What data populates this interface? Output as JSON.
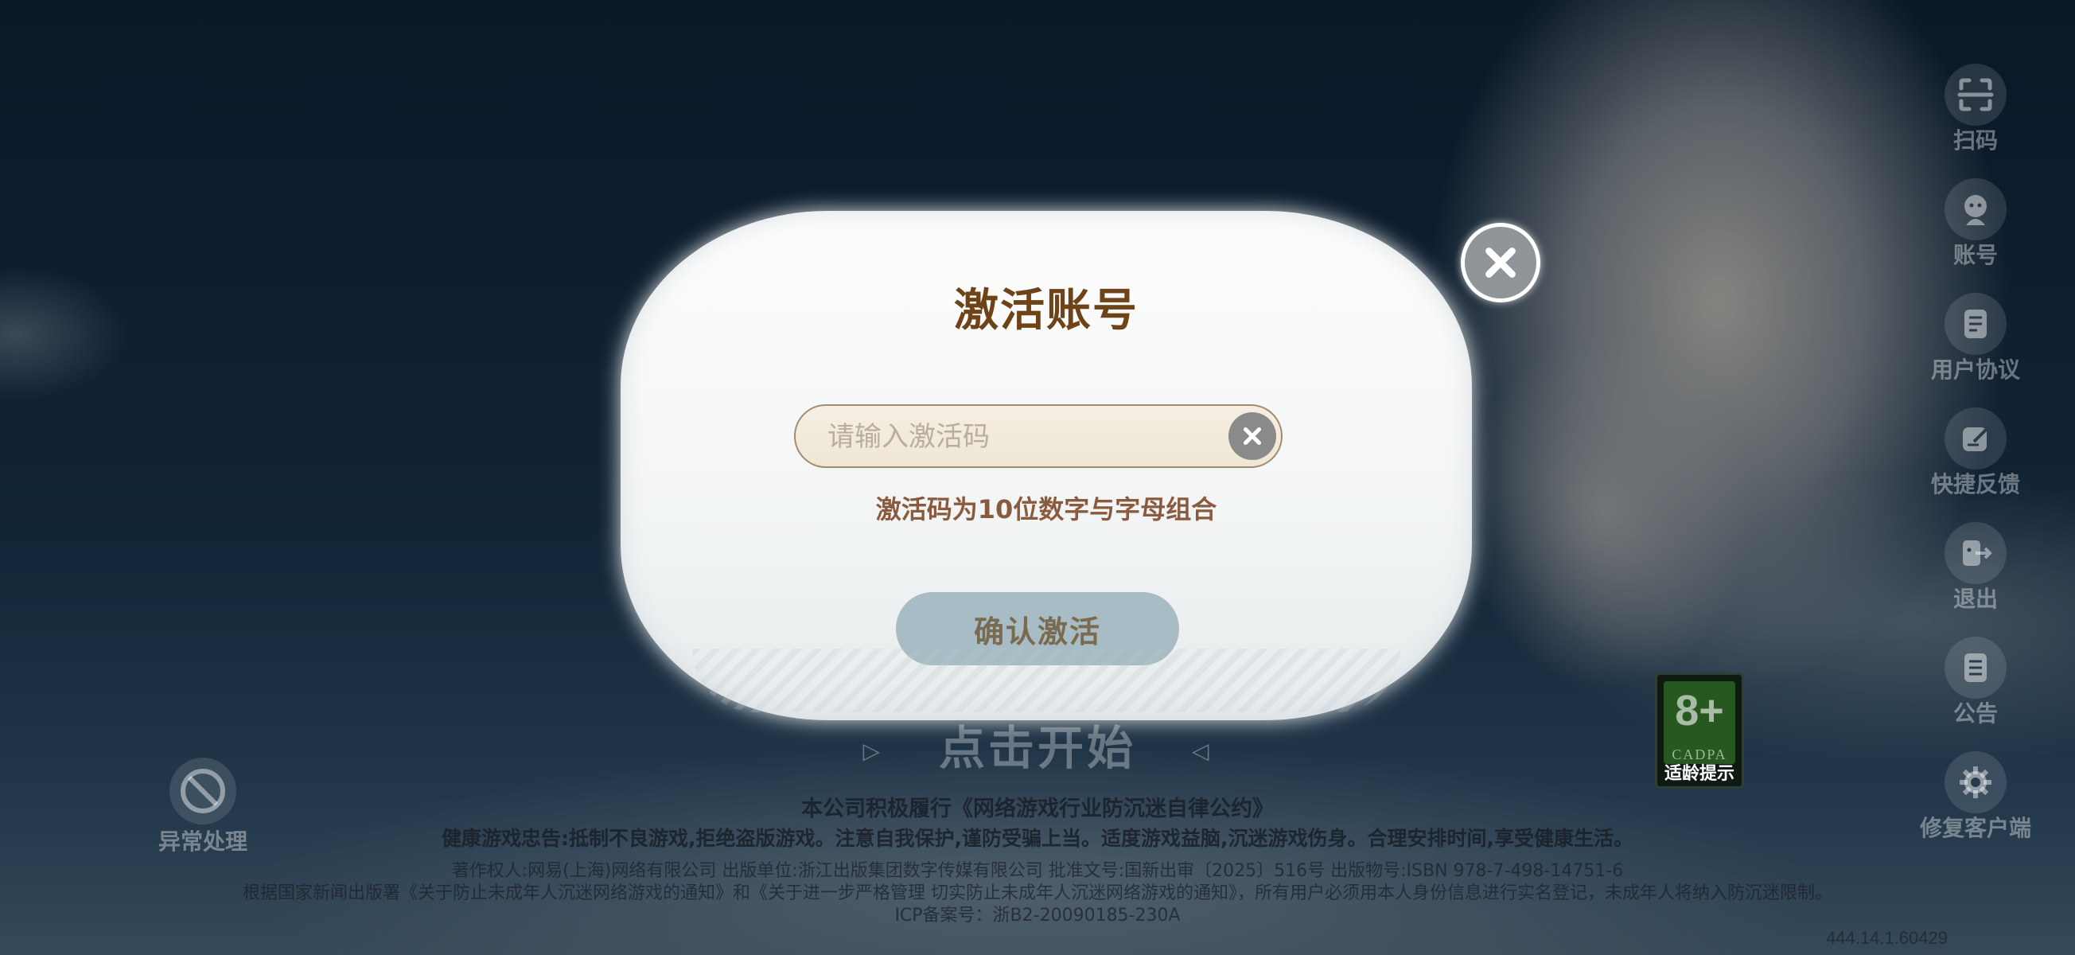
{
  "side_menu": [
    {
      "label": "扫码",
      "icon": "scan-icon"
    },
    {
      "label": "账号",
      "icon": "account-icon"
    },
    {
      "label": "用户协议",
      "icon": "document-icon"
    },
    {
      "label": "快捷反馈",
      "icon": "feedback-icon"
    },
    {
      "label": "退出",
      "icon": "exit-icon"
    },
    {
      "label": "公告",
      "icon": "notice-icon"
    },
    {
      "label": "修复客户端",
      "icon": "gear-icon"
    }
  ],
  "abnormal": {
    "label": "异常处理",
    "icon": "forbidden-icon"
  },
  "age_badge": {
    "age": "8+",
    "org": "CADPA",
    "tip": "适龄提示",
    "color": "#3a8b2b"
  },
  "start_text": "点击开始",
  "footer": {
    "line1": "本公司积极履行《网络游戏行业防沉迷自律公约》",
    "line2": "健康游戏忠告:抵制不良游戏,拒绝盗版游戏。注意自我保护,谨防受骗上当。适度游戏益脑,沉迷游戏伤身。合理安排时间,享受健康生活。",
    "line3": "著作权人:网易(上海)网络有限公司 出版单位:浙江出版集团数字传媒有限公司 批准文号:国新出审〔2025〕516号 出版物号:ISBN 978-7-498-14751-6",
    "line4": "根据国家新闻出版署《关于防止未成年人沉迷网络游戏的通知》和《关于进一步严格管理 切实防止未成年人沉迷网络游戏的通知》，所有用户必须用本人身份信息进行实名登记，未成年人将纳入防沉迷限制。",
    "line5": "ICP备案号：浙B2-20090185-230A"
  },
  "version": "444.14.1.60429",
  "dialog": {
    "title": "激活账号",
    "input_placeholder": "请输入激活码",
    "input_value": "",
    "hint": "激活码为10位数字与字母组合",
    "confirm_label": "确认激活"
  },
  "colors": {
    "title": "#6e4318",
    "hint": "#8a5a3e",
    "confirm_bg": "#a7bcc4",
    "input_border": "#a08a6d"
  }
}
